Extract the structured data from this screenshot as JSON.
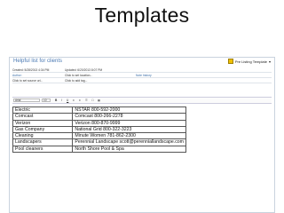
{
  "slide": {
    "title": "Templates"
  },
  "note": {
    "title": "Helpful list for clients",
    "template_label": "Pre Listing Template",
    "template_caret": "▾",
    "created": "Created: 5/28/2013 4:34 PM",
    "updated": "Updated: 6/20/2013 8:07 PM",
    "author_label": "Author:",
    "url_placeholder": "Click to set location...",
    "note_history": "Note history",
    "reminder_placeholder": "Click to set source url...",
    "tag_placeholder": "Click to add tag...",
    "font_name": "Arial",
    "font_size": "10"
  },
  "table": {
    "rows": [
      [
        "Electric",
        "NSTAR 800-592-2000"
      ],
      [
        "Comcast",
        "Comcast 800-266-2278"
      ],
      [
        "Verizon",
        "Verizon 800-870-9999"
      ],
      [
        "Gas Company",
        "National Grid 800-322-3223"
      ],
      [
        "Cleaning",
        "Minute Women 781-862-2300"
      ],
      [
        "Landscapers",
        "Perennial Landscape scott@perenniallandscape.com"
      ],
      [
        "Pool cleaners",
        "North Shore Pool & Spa"
      ]
    ]
  }
}
